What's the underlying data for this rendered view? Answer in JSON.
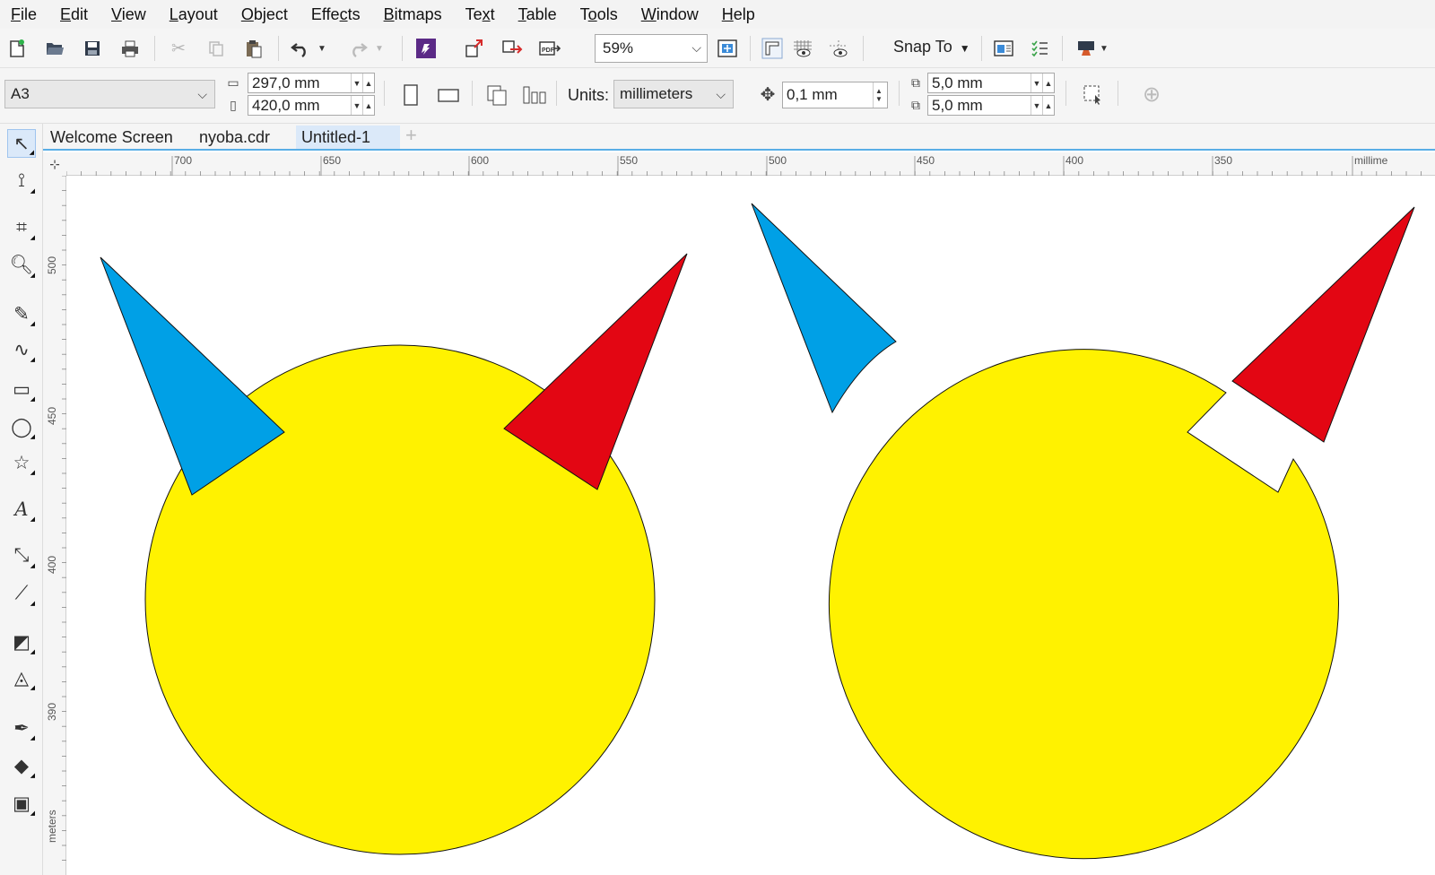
{
  "menu": {
    "items": [
      {
        "u": "F",
        "rest": "ile"
      },
      {
        "u": "E",
        "rest": "dit"
      },
      {
        "u": "V",
        "rest": "iew"
      },
      {
        "u": "L",
        "rest": "ayout"
      },
      {
        "u": "O",
        "rest": "bject"
      },
      {
        "pre": "Effe",
        "u": "c",
        "rest": "ts"
      },
      {
        "u": "B",
        "rest": "itmaps"
      },
      {
        "pre": "Te",
        "u": "x",
        "rest": "t"
      },
      {
        "u": "T",
        "rest": "able"
      },
      {
        "pre": "T",
        "u": "o",
        "rest": "ols"
      },
      {
        "u": "W",
        "rest": "indow"
      },
      {
        "u": "H",
        "rest": "elp"
      }
    ]
  },
  "toolbar": {
    "zoom": "59%",
    "snap_to": "Snap To"
  },
  "property_bar": {
    "page_size": "A3",
    "width": "297,0 mm",
    "height": "420,0 mm",
    "units_label": "Units:",
    "units_value": "millimeters",
    "nudge": "0,1 mm",
    "dup_x": "5,0 mm",
    "dup_y": "5,0 mm"
  },
  "tabs": [
    {
      "label": "Welcome Screen"
    },
    {
      "label": "nyoba.cdr"
    },
    {
      "label": "Untitled-1"
    }
  ],
  "rulers": {
    "horizontal": [
      "700",
      "650",
      "600",
      "550",
      "500",
      "450",
      "400",
      "350",
      "millime"
    ],
    "vertical": [
      "500",
      "450",
      "400",
      "390",
      "meters"
    ]
  },
  "colors": {
    "yellow": "#FFF200",
    "blue": "#00A0E6",
    "red": "#E30613",
    "accent": "#5AAEE6"
  },
  "icons": {
    "tools": [
      "pick-icon",
      "shape-icon",
      "crop-icon",
      "zoom-icon",
      "freehand-icon",
      "artistic-media-icon",
      "rectangle-icon",
      "ellipse-icon",
      "polygon-icon",
      "text-icon",
      "dimension-icon",
      "connector-icon",
      "drop-shadow-icon",
      "transparency-icon",
      "eyedropper-icon",
      "interactive-fill-icon",
      "smart-fill-icon"
    ]
  }
}
